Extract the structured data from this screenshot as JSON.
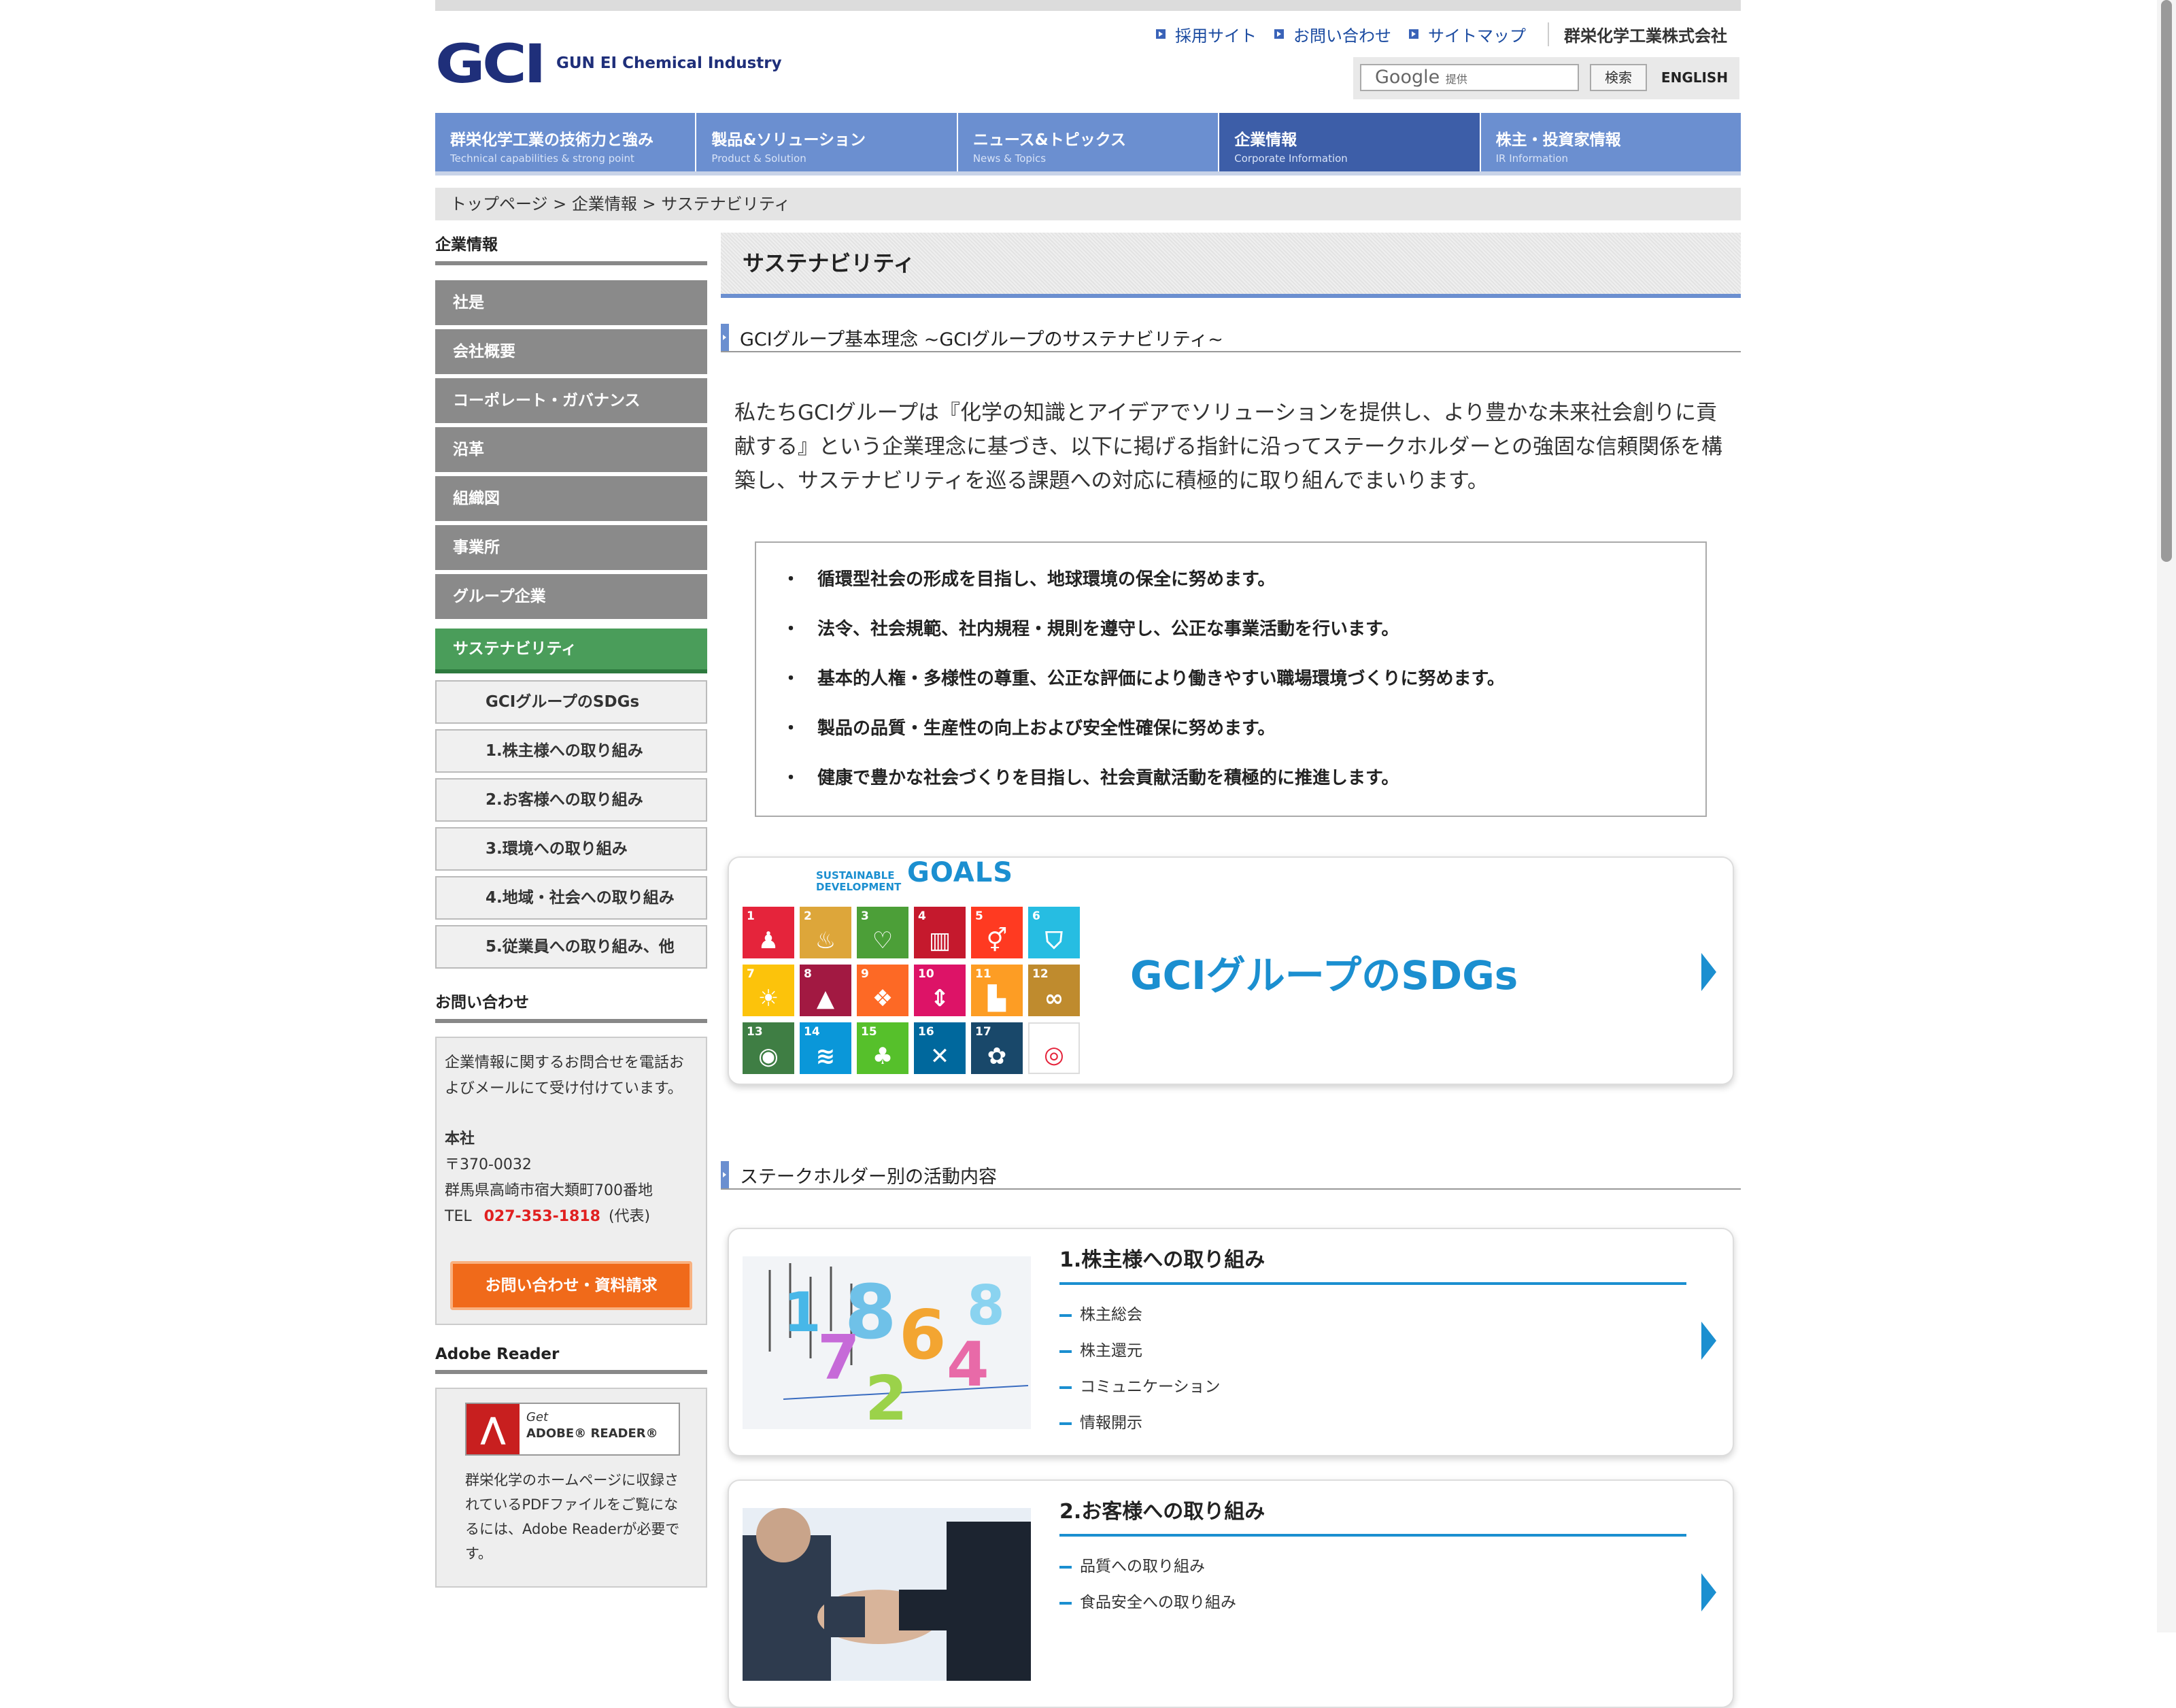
{
  "header": {
    "logo_mark": "GCI",
    "logo_sub": "GUN EI Chemical Industry",
    "top_links": [
      "採用サイト",
      "お問い合わせ",
      "サイトマップ"
    ],
    "company_name": "群栄化学工業株式会社",
    "search": {
      "placeholder_brand": "Google",
      "placeholder_suffix": "提供",
      "button": "検索"
    },
    "english": "ENGLISH"
  },
  "gnav": [
    {
      "ja": "群栄化学工業の技術力と強み",
      "en": "Technical capabilities & strong point"
    },
    {
      "ja": "製品&ソリューション",
      "en": "Product & Solution"
    },
    {
      "ja": "ニュース&トピックス",
      "en": "News & Topics"
    },
    {
      "ja": "企業情報",
      "en": "Corporate Information"
    },
    {
      "ja": "株主・投資家情報",
      "en": "IR Information"
    }
  ],
  "breadcrumb": "トップページ > 企業情報 > サステナビリティ",
  "sidebar": {
    "heading": "企業情報",
    "items": [
      "社是",
      "会社概要",
      "コーポレート・ガバナンス",
      "沿革",
      "組織図",
      "事業所",
      "グループ企業"
    ],
    "active": "サステナビリティ",
    "subitems": [
      "GCIグループのSDGs",
      "1.株主様への取り組み",
      "2.お客様への取り組み",
      "3.環境への取り組み",
      "4.地域・社会への取り組み",
      "5.従業員への取り組み、他"
    ],
    "contact": {
      "heading": "お問い合わせ",
      "text": "企業情報に関するお問合せを電話およびメールにて受け付けています。",
      "office": "本社",
      "postal": "〒370-0032",
      "address": "群馬県高崎市宿大類町700番地",
      "tel_label": "TEL",
      "tel": "027-353-1818",
      "tel_note": "(代表)",
      "button": "お問い合わせ・資料請求"
    },
    "adobe": {
      "heading": "Adobe Reader",
      "badge_get": "Get",
      "badge_name": "ADOBE® READER®",
      "text": "群栄化学のホームページに収録されているPDFファイルをご覧になるには、Adobe Readerが必要です。"
    }
  },
  "main": {
    "title": "サステナビリティ",
    "section1": "GCIグループ基本理念 ~GCIグループのサステナビリティ~",
    "intro": "私たちGCIグループは『化学の知識とアイデアでソリューションを提供し、より豊かな未来社会創りに貢献する』という企業理念に基づき、以下に掲げる指針に沿ってステークホルダーとの強固な信頼関係を構築し、サステナビリティを巡る課題への対応に積極的に取り組んでまいります。",
    "policies": [
      "循環型社会の形成を目指し、地球環境の保全に努めます。",
      "法令、社会規範、社内規程・規則を遵守し、公正な事業活動を行います。",
      "基本的人権・多様性の尊重、公正な評価により働きやすい職場環境づくりに努めます。",
      "製品の品質・生産性の向上および安全性確保に努めます。",
      "健康で豊かな社会づくりを目指し、社会貢献活動を積極的に推進します。"
    ],
    "policy_bullet": "・",
    "sdg_card": {
      "logo_line1": "SUSTAINABLE",
      "logo_line2": "DEVELOPMENT",
      "logo_goals": "GOALS",
      "title": "GCIグループのSDGs",
      "goals": [
        {
          "n": "1",
          "c": "#e5243b",
          "i": "♟"
        },
        {
          "n": "2",
          "c": "#dda63a",
          "i": "♨"
        },
        {
          "n": "3",
          "c": "#4c9f38",
          "i": "♡"
        },
        {
          "n": "4",
          "c": "#c5192d",
          "i": "▥"
        },
        {
          "n": "5",
          "c": "#ff3a21",
          "i": "⚥"
        },
        {
          "n": "6",
          "c": "#26bde2",
          "i": "⛉"
        },
        {
          "n": "7",
          "c": "#fcc30b",
          "i": "☀"
        },
        {
          "n": "8",
          "c": "#a21942",
          "i": "▲"
        },
        {
          "n": "9",
          "c": "#fd6925",
          "i": "❖"
        },
        {
          "n": "10",
          "c": "#dd1367",
          "i": "⇕"
        },
        {
          "n": "11",
          "c": "#fd9d24",
          "i": "▙"
        },
        {
          "n": "12",
          "c": "#bf8b2e",
          "i": "∞"
        },
        {
          "n": "13",
          "c": "#3f7e44",
          "i": "◉"
        },
        {
          "n": "14",
          "c": "#0a97d9",
          "i": "≋"
        },
        {
          "n": "15",
          "c": "#56c02b",
          "i": "♣"
        },
        {
          "n": "16",
          "c": "#00689d",
          "i": "✕"
        },
        {
          "n": "17",
          "c": "#19486a",
          "i": "✿"
        },
        {
          "n": "",
          "c": "#ffffff",
          "i": "◎"
        }
      ]
    },
    "section2": "ステークホルダー別の活動内容",
    "stakeholders": [
      {
        "title": "1.株主様への取り組み",
        "items": [
          "株主総会",
          "株主還元",
          "コミュニケーション",
          "情報開示"
        ]
      },
      {
        "title": "2.お客様への取り組み",
        "items": [
          "品質への取り組み",
          "食品安全への取り組み"
        ]
      }
    ]
  }
}
